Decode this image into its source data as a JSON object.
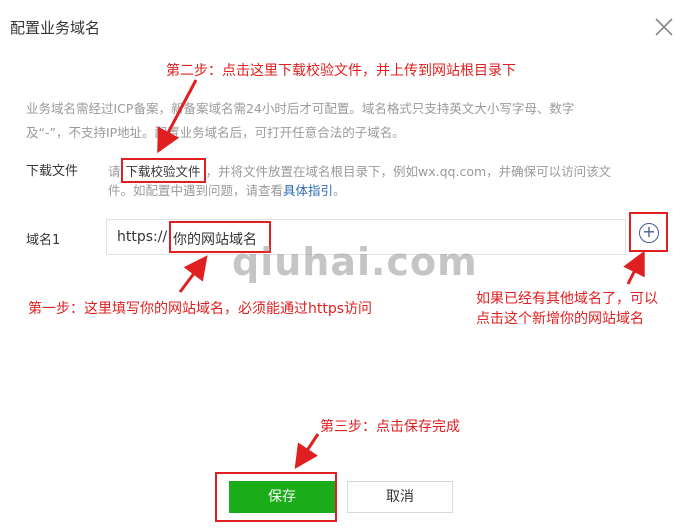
{
  "dialog": {
    "title": "配置业务域名",
    "description_line1": "业务域名需经过ICP备案，新备案域名需24小时后才可配置。域名格式只支持英文大小写字母、数字",
    "description_line2": "及“-”，不支持IP地址。配置业务域名后，可打开任意合法的子域名。"
  },
  "download": {
    "label": "下载文件",
    "prefix": "请",
    "link": "下载校验文件",
    "line1_rest": "，并将文件放置在域名根目录下，例如wx.qq.com，并确保可以访问该文",
    "line2_text": "件。如配置中遇到问题，请查看",
    "line2_link": "具体指引",
    "line2_end": "。"
  },
  "domain": {
    "label": "域名1",
    "prefix": "https://",
    "value": "你的网站域名"
  },
  "buttons": {
    "save": "保存",
    "cancel": "取消"
  },
  "annotations": {
    "step2": "第二步：点击这里下载校验文件，并上传到网站根目录下",
    "step1": "第一步：这里填写你的网站域名，必须能通过https访问",
    "add_line1": "如果已经有其他域名了，可以",
    "add_line2": "点击这个新增你的网站域名",
    "step3": "第三步：点击保存完成"
  },
  "watermark": "qiuhai.com",
  "colors": {
    "annotation_red": "#e02020",
    "save_green": "#1aad19",
    "link_blue": "#2d6bb2"
  },
  "icons": [
    "close-icon",
    "add-circle-icon"
  ]
}
